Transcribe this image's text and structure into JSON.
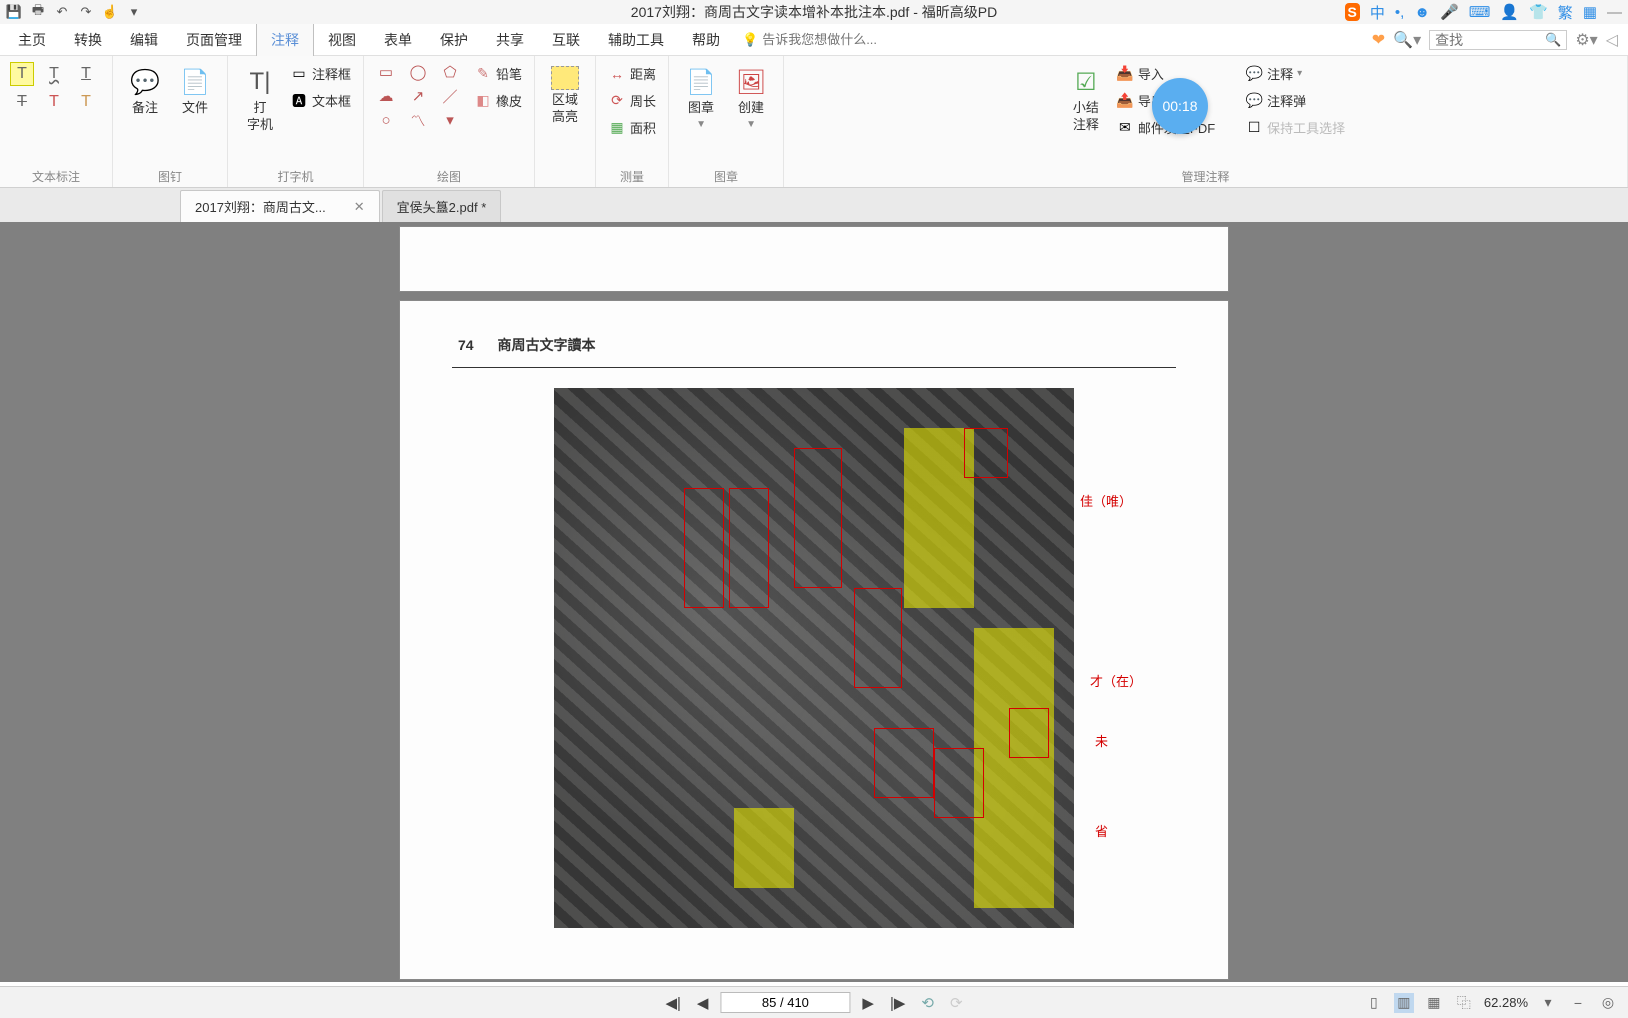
{
  "title": "2017刘翔：商周古文字读本增补本批注本.pdf - 福昕高级PD",
  "ime": {
    "badge": "S",
    "lang": "中",
    "punct": "•,",
    "emoji": "☻",
    "mic": "🎤",
    "kb": "⌨",
    "shirt": "👕",
    "trad": "繁",
    "grid": "▦"
  },
  "menu": {
    "items": [
      "主页",
      "转换",
      "编辑",
      "页面管理",
      "注释",
      "视图",
      "表单",
      "保护",
      "共享",
      "互联",
      "辅助工具",
      "帮助"
    ],
    "active_index": 4,
    "tell_me_placeholder": "告诉我您想做什么...",
    "search_placeholder": "查找"
  },
  "ribbon": {
    "text_annot": {
      "label": "文本标注"
    },
    "pin": {
      "note": "备注",
      "file": "文件",
      "label": "图钉"
    },
    "typewriter": {
      "main": "打\n字机",
      "annot_frame": "注释框",
      "text_frame": "文本框",
      "label": "打字机"
    },
    "drawing": {
      "pencil": "铅笔",
      "eraser": "橡皮",
      "label": "绘图"
    },
    "area": {
      "main": "区域\n高亮"
    },
    "measure": {
      "dist": "距离",
      "peri": "周长",
      "area": "面积",
      "label": "测量"
    },
    "stamp": {
      "stamp": "图章",
      "create": "创建",
      "label": "图章"
    },
    "summary": {
      "main": "小结\n注释"
    },
    "manage": {
      "import": "导入",
      "export": "导出",
      "mail": "邮件发送FDF",
      "annot": "注释",
      "annot_d": "注释弹",
      "keep": "保持工具选择",
      "label": "管理注释"
    }
  },
  "timer": "00:18",
  "tabs": {
    "active": "2017刘翔：商周古文...",
    "second": "宜侯夨簋2.pdf *"
  },
  "page": {
    "number": "74",
    "book_title": "商周古文字讀本",
    "annotations": {
      "a1": "佳（唯）",
      "a2": "才（在）",
      "a3": "未",
      "a4": "省"
    }
  },
  "status": {
    "page_display": "85 / 410",
    "zoom": "62.28%"
  }
}
